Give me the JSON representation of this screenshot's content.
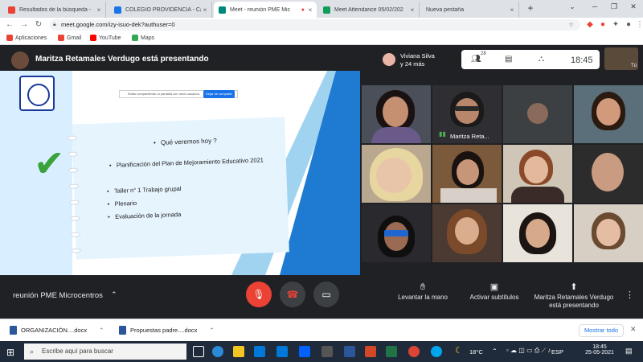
{
  "browser": {
    "tabs": [
      {
        "label": "Resultados de la búsqueda -",
        "favicon_color": "#ea4335",
        "active": false
      },
      {
        "label": "COLEGIO PROVIDENCIA - Cal",
        "favicon_color": "#1a73e8",
        "active": false
      },
      {
        "label": "Meet - reunión PME Mic",
        "favicon_color": "#00897b",
        "active": true
      },
      {
        "label": "Meet Attendance 05/02/202",
        "favicon_color": "#0f9d58",
        "active": false
      },
      {
        "label": "Nueva pestaña",
        "favicon_color": "#9aa0a6",
        "active": false
      }
    ],
    "new_tab": "+",
    "url": "meet.google.com/izy-isuo-dek?authuser=0",
    "bookmarks": [
      {
        "label": "Aplicaciones",
        "color": "#ea4335"
      },
      {
        "label": "Gmail",
        "color": "#ea4335"
      },
      {
        "label": "YouTube",
        "color": "#ff0000"
      },
      {
        "label": "Maps",
        "color": "#34a853"
      }
    ]
  },
  "meet": {
    "presenting_title": "Maritza Retamales Verdugo está presentando",
    "host_name": "Viviana Silva",
    "host_sub": "y 24 más",
    "participant_count": "28",
    "clock": "18:45",
    "self_label": "Tú",
    "meeting_name": "reunión PME Microcentros",
    "tile_name": "Maritza Reta...",
    "actions": {
      "raise_hand": "Levantar la mano",
      "captions": "Activar subtítulos",
      "presenting_line1": "Maritza Retamales Verdugo",
      "presenting_line2": "está presentando"
    }
  },
  "slide": {
    "share_notice": "Estás compartiendo tu pantalla con otros usuarios.",
    "share_stop": "Dejar de compartir",
    "title": "Qué veremos hoy ?",
    "items": [
      "Planificación del Plan de Mejoramiento Educativo 2021",
      "Taller n° 1 Trabajo grupal",
      "Plenario",
      "Evaluación de la jornada"
    ]
  },
  "downloads": {
    "items": [
      {
        "label": "ORGANIZACIÓN....docx"
      },
      {
        "label": "Propuestas padre....docx"
      }
    ],
    "show_all": "Mostrar todo"
  },
  "taskbar": {
    "search_placeholder": "Escribe aquí para buscar",
    "weather": "18°C",
    "lang": "ESP",
    "time": "18:45",
    "date": "25-05-2021"
  }
}
